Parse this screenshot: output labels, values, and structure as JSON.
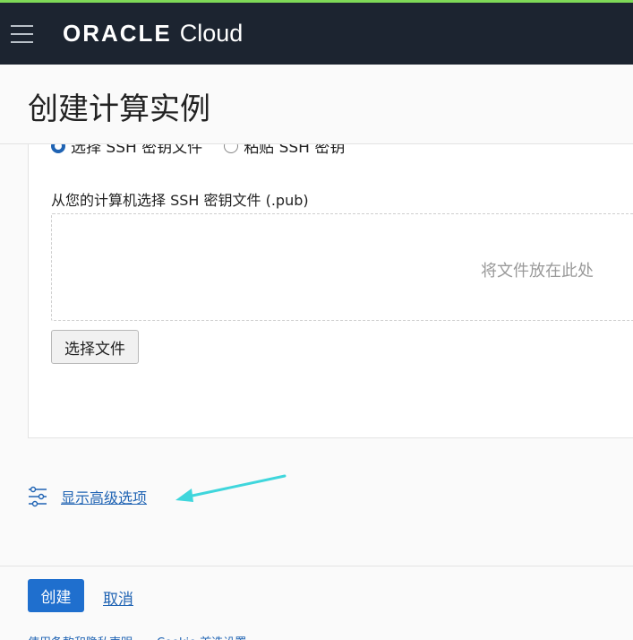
{
  "header": {
    "logo_oracle": "ORACLE",
    "logo_cloud": "Cloud"
  },
  "page": {
    "title": "创建计算实例"
  },
  "ssh": {
    "radio_options": [
      {
        "label": "选择 SSH 密钥文件",
        "checked": true
      },
      {
        "label": "粘贴 SSH 密钥",
        "checked": false
      }
    ],
    "file_label": "从您的计算机选择 SSH 密钥文件 (.pub)",
    "dropzone_text": "将文件放在此处",
    "choose_file_button": "选择文件"
  },
  "advanced": {
    "link_label": "显示高级选项",
    "icon": "sliders-icon",
    "annotation_arrow_color": "#3fd6dc"
  },
  "footer": {
    "create_label": "创建",
    "cancel_label": "取消",
    "links": [
      "使用条款和隐私声明",
      "Cookie 首选设置"
    ]
  },
  "colors": {
    "header_bg": "#1c2430",
    "accent_green": "#7ed957",
    "primary_button": "#1f6fce",
    "link": "#1f63b3"
  }
}
